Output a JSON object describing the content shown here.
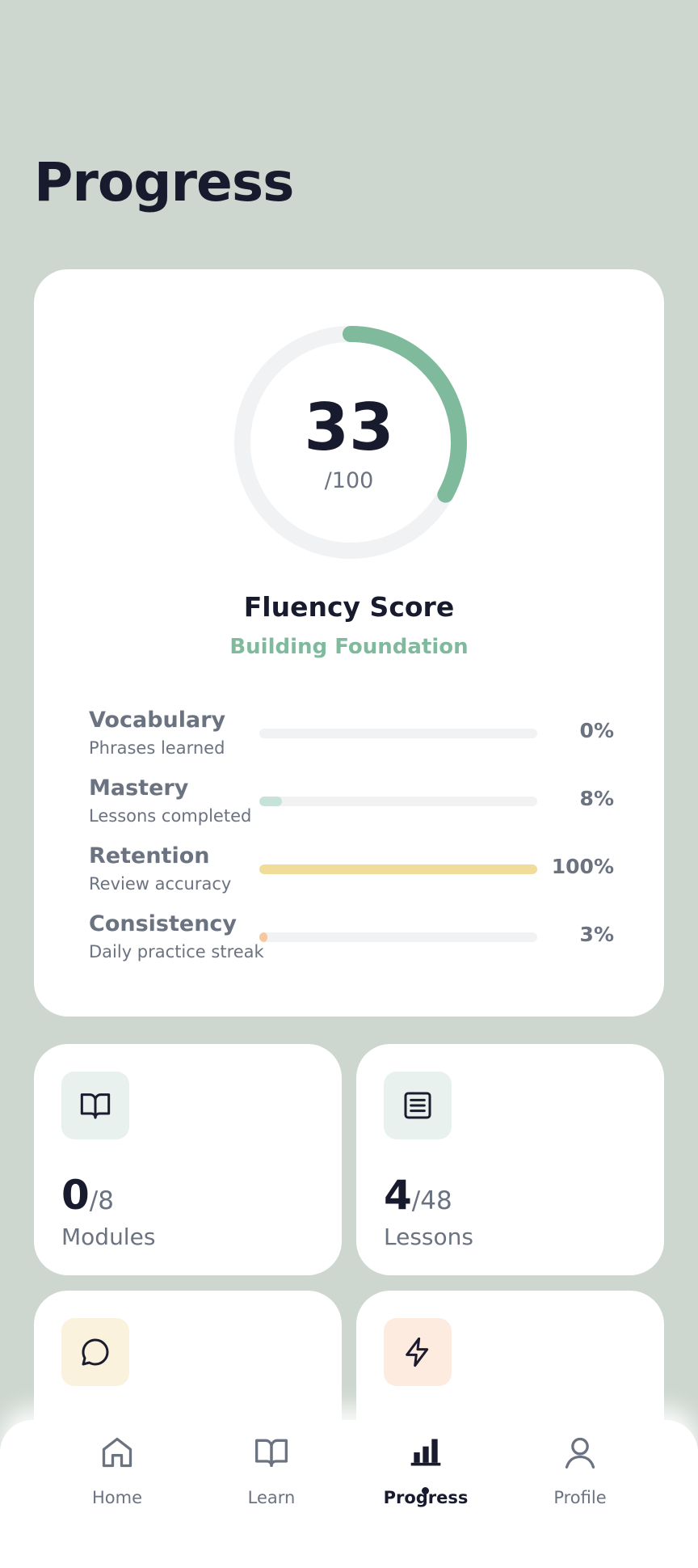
{
  "header": {
    "title": "Progress"
  },
  "score": {
    "value": "33",
    "max_label": "/100",
    "fraction": 0.33,
    "title": "Fluency Score",
    "level": "Building Foundation"
  },
  "metrics": [
    {
      "name": "Vocabulary",
      "desc": "Phrases learned",
      "pct_label": "0%",
      "pct": 0,
      "color": "#c7e2d6"
    },
    {
      "name": "Mastery",
      "desc": "Lessons completed",
      "pct_label": "8%",
      "pct": 8,
      "color": "#c7e2d6"
    },
    {
      "name": "Retention",
      "desc": "Review accuracy",
      "pct_label": "100%",
      "pct": 100,
      "color": "#f1dc99"
    },
    {
      "name": "Consistency",
      "desc": "Daily practice streak",
      "pct_label": "3%",
      "pct": 3,
      "color": "#f5c89e"
    }
  ],
  "stats": [
    {
      "value": "0",
      "total": "/8",
      "label": "Modules",
      "icon": "book-open-icon",
      "icon_bg": "#e8f1ed"
    },
    {
      "value": "4",
      "total": "/48",
      "label": "Lessons",
      "icon": "list-icon",
      "icon_bg": "#e8f1ed"
    },
    {
      "icon": "chat-bubble-icon",
      "icon_bg": "#faf2dc"
    },
    {
      "icon": "lightning-icon",
      "icon_bg": "#fdebe0"
    }
  ],
  "nav": {
    "items": [
      {
        "label": "Home",
        "icon": "home-icon"
      },
      {
        "label": "Learn",
        "icon": "book-icon"
      },
      {
        "label": "Progress",
        "icon": "bar-chart-icon",
        "active": true
      },
      {
        "label": "Profile",
        "icon": "user-icon"
      }
    ]
  },
  "colors": {
    "background": "#cdd6cf",
    "accent": "#7fba9d",
    "ring_track": "#f1f2f4",
    "text_dark": "#181b2d",
    "text_muted": "#6b7280"
  }
}
